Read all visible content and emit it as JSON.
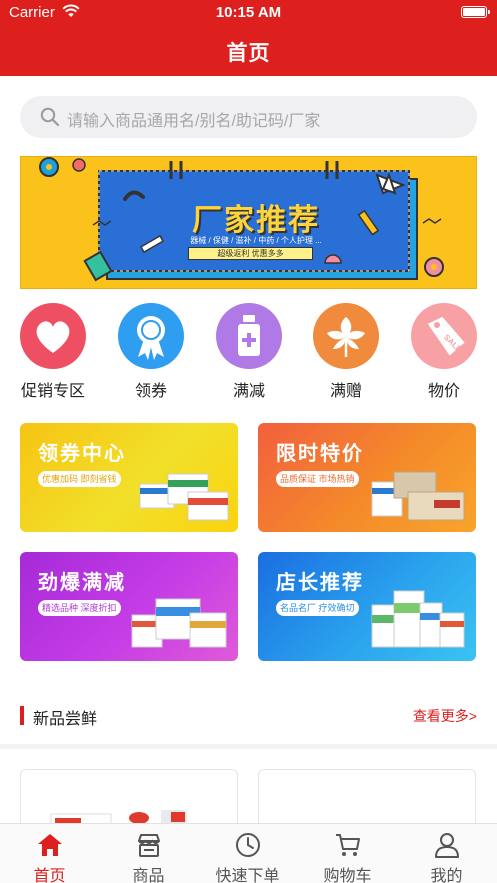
{
  "status_bar": {
    "carrier": "Carrier",
    "time": "10:15 AM"
  },
  "header": {
    "title": "首页"
  },
  "search": {
    "placeholder": "请输入商品通用名/别名/助记码/厂家"
  },
  "banner": {
    "title": "厂家推荐",
    "subtitle": "器械 / 保健 / 滋补 / 中药 / 个人护理 ...",
    "tagline": "超级返利  优惠多多"
  },
  "entries": [
    {
      "label": "促销专区",
      "icon": "heart-icon",
      "color": "#ef4f63"
    },
    {
      "label": "领券",
      "icon": "badge-ribbon-icon",
      "color": "#2f9ef0"
    },
    {
      "label": "满减",
      "icon": "medicine-bottle-icon",
      "color": "#b07ae6"
    },
    {
      "label": "满赠",
      "icon": "leaf-icon",
      "color": "#f08a3d"
    },
    {
      "label": "物价",
      "icon": "sale-tag-icon",
      "color": "#f7a1a4"
    }
  ],
  "promos": [
    {
      "title": "领券中心",
      "tags": "优惠加码 即刻省钱"
    },
    {
      "title": "限时特价",
      "tags": "品质保证 市场热销"
    },
    {
      "title": "劲爆满减",
      "tags": "精选品种 深度折扣"
    },
    {
      "title": "店长推荐",
      "tags": "名品名厂 疗效确切"
    }
  ],
  "section": {
    "title": "新品尝鲜",
    "more": "查看更多>"
  },
  "tabbar": [
    {
      "label": "首页",
      "icon": "home-icon",
      "active": true
    },
    {
      "label": "商品",
      "icon": "shop-icon",
      "active": false
    },
    {
      "label": "快速下单",
      "icon": "clock-icon",
      "active": false
    },
    {
      "label": "购物车",
      "icon": "cart-icon",
      "active": false
    },
    {
      "label": "我的",
      "icon": "user-icon",
      "active": false
    }
  ],
  "colors": {
    "brand": "#dd1f1d",
    "banner": "#fcc21c"
  }
}
